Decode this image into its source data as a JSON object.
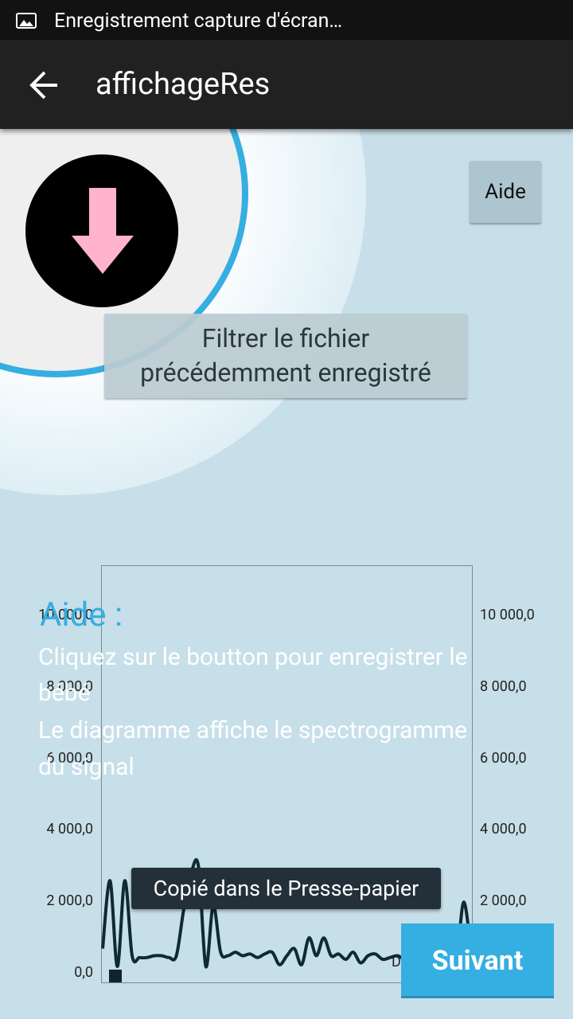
{
  "status_bar": {
    "notification_text": "Enregistrement capture d'écran…",
    "icon": "image-icon"
  },
  "action_bar": {
    "title": "affichageRes",
    "back_icon": "arrow-back-icon"
  },
  "buttons": {
    "record_icon": "arrow-down-icon",
    "aide": "Aide",
    "filter_line1": "Filtrer le fichier",
    "filter_line2": "précédemment enregistré",
    "next": "Suivant"
  },
  "help": {
    "title": "Aide :",
    "line1": "Cliquez sur le boutton pour enregistrer le",
    "line2": "bébé",
    "line3": " Le diagramme affiche le spectrogramme",
    "line4": "du signal"
  },
  "toast": "Copié dans le Presse-papier",
  "chart_data": {
    "type": "line",
    "y_ticks": [
      "0,0",
      "2 000,0",
      "4 000,0",
      "6 000,0",
      "8 000,0",
      "10 000,0"
    ],
    "y_tick_values": [
      0,
      2000,
      4000,
      6000,
      8000,
      10000
    ],
    "ylim": [
      0,
      10000
    ],
    "series": [
      {
        "x": [
          0,
          1,
          2,
          3,
          4,
          5,
          6,
          7,
          8,
          9,
          10,
          11,
          12,
          13,
          14,
          15,
          16,
          17,
          18,
          19,
          20,
          21,
          22,
          23,
          24,
          25,
          26,
          27,
          28,
          29,
          30,
          31,
          32,
          33,
          34,
          35,
          36,
          37,
          38,
          39,
          40,
          41,
          42,
          43,
          44,
          45,
          46,
          47,
          48,
          49,
          50
        ],
        "y": [
          700,
          2600,
          200,
          2600,
          500,
          450,
          450,
          500,
          500,
          450,
          500,
          1800,
          2800,
          3000,
          200,
          1900,
          600,
          500,
          600,
          500,
          550,
          450,
          550,
          600,
          250,
          500,
          700,
          250,
          1000,
          500,
          1000,
          500,
          550,
          400,
          600,
          300,
          500,
          550,
          400,
          450,
          500,
          400,
          450,
          500,
          550,
          600,
          500,
          450,
          400,
          2000,
          600
        ],
        "color": "#0f2a33"
      }
    ],
    "legend_visible_text": "D"
  },
  "colors": {
    "accent": "#35aee2",
    "background": "#c7dfe9",
    "action_bar": "#212121"
  }
}
